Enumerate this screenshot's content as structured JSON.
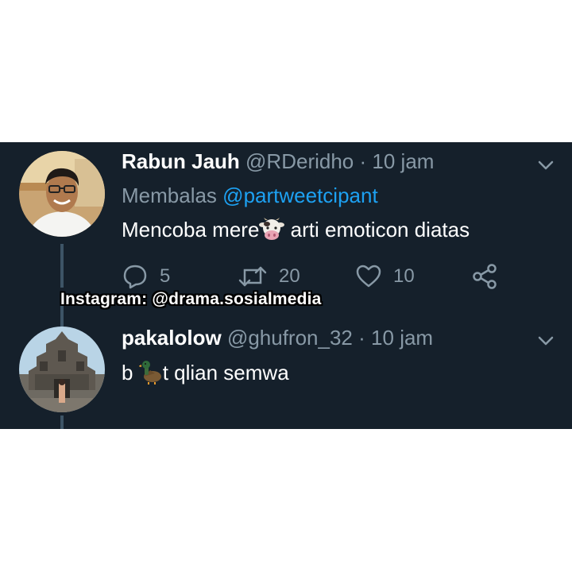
{
  "tweets": [
    {
      "display_name": "Rabun Jauh",
      "handle": "@RDeridho",
      "separator": "·",
      "time": "10 jam",
      "reply_prefix": "Membalas",
      "reply_mention": "@partweetcipant",
      "text_before_emoji": "Mencoba mere",
      "emoji_icon": "cow-face-icon",
      "text_after_emoji": " arti emoticon diatas",
      "actions": {
        "replies": "5",
        "retweets": "20",
        "likes": "10"
      }
    },
    {
      "display_name": "pakalolow",
      "handle": "@ghufron_32",
      "separator": "·",
      "time": "10 jam",
      "text_before_emoji": "b",
      "emoji_icon": "duck-icon",
      "text_after_emoji": "t qlian semwa"
    }
  ],
  "watermark": "Instagram: @drama.sosialmedia",
  "colors": {
    "background": "#15202b",
    "muted_text": "#8899a6",
    "link": "#1da1f2",
    "primary_text": "#ffffff",
    "thread_line": "#3d5466"
  }
}
